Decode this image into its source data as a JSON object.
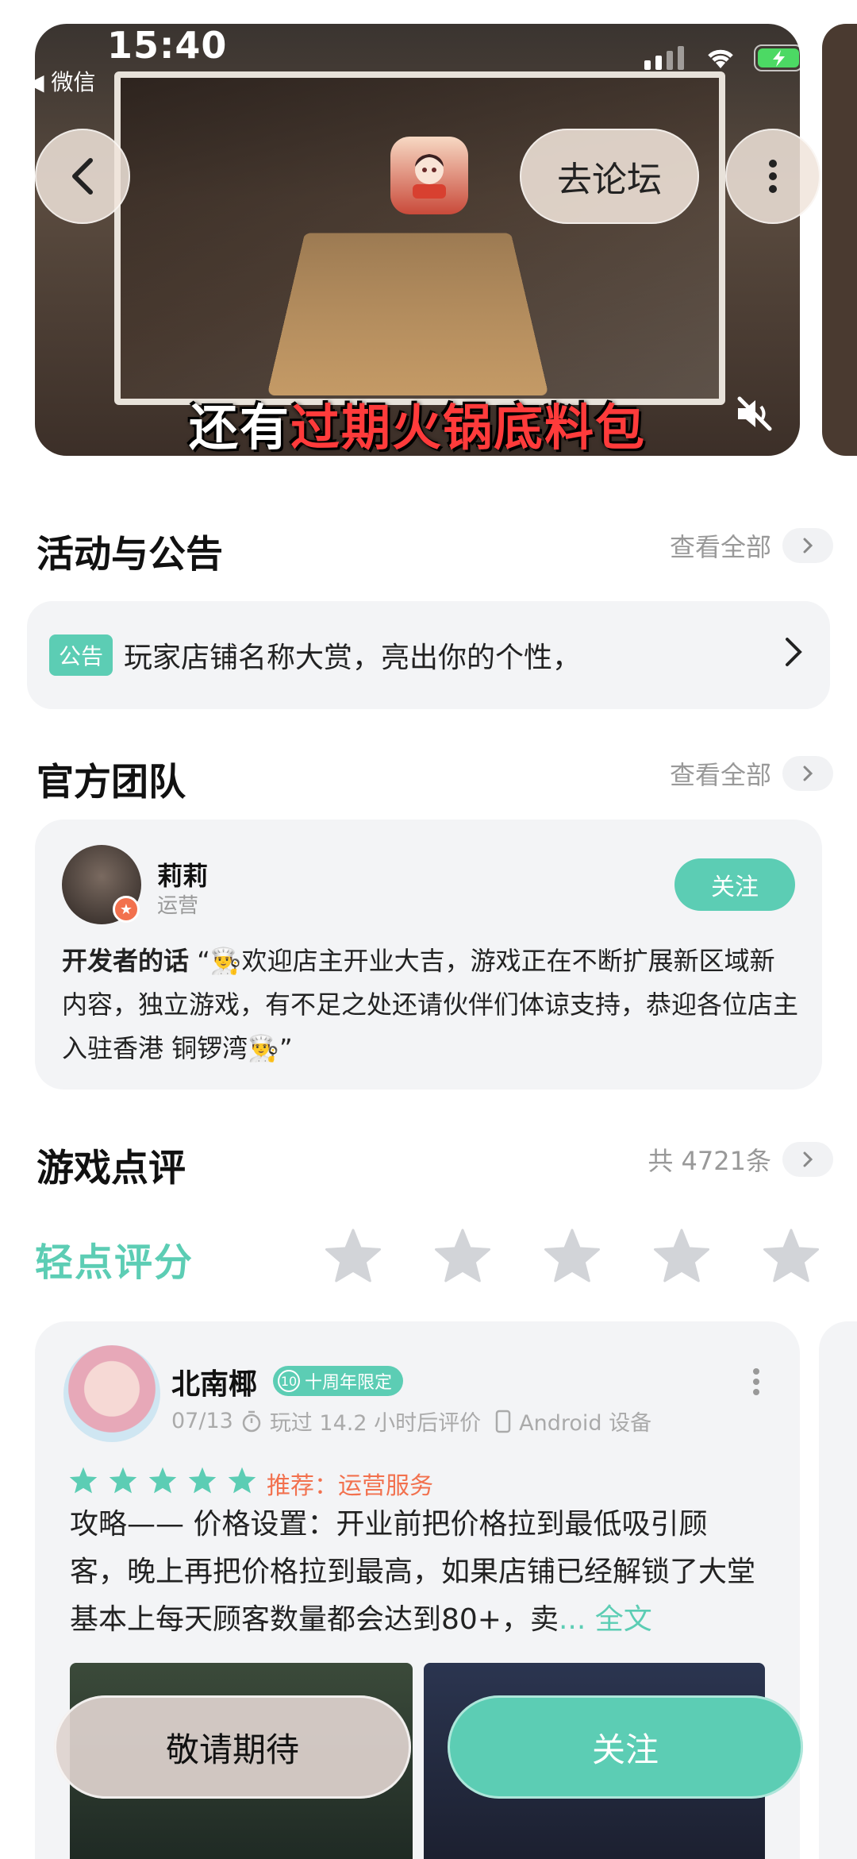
{
  "status_bar": {
    "time": "15:40",
    "back_app": "◀ 微信"
  },
  "hero": {
    "caption_normal": "还有",
    "caption_highlight": "过期火锅底料包",
    "forum_button": "去论坛"
  },
  "announcements": {
    "title": "活动与公告",
    "see_all": "查看全部",
    "tag": "公告",
    "text": "玩家店铺名称大赏，亮出你的个性，"
  },
  "team": {
    "title": "官方团队",
    "see_all": "查看全部",
    "member_name": "莉莉",
    "member_role": "运营",
    "follow": "关注",
    "dev_label": "开发者的话",
    "dev_words": "“👨‍🍳欢迎店主开业大吉，游戏正在不断扩展新区域新内容，独立游戏，有不足之处还请伙伴们体谅支持，恭迎各位店主入驻香港 铜锣湾👨‍🍳”"
  },
  "reviews": {
    "title": "游戏点评",
    "total": "共 4721条",
    "rate_label": "轻点评分",
    "item": {
      "user": "北南椰",
      "badge_num": "10",
      "badge_text": "十周年限定",
      "date": "07/13",
      "played": "玩过 14.2 小时后评价",
      "device": "Android 设备",
      "rating": 5,
      "recommend": "推荐：运营服务",
      "text": "攻略—— 价格设置：开业前把价格拉到最低吸引顾客，晚上再把价格拉到最高，如果店铺已经解锁了大堂基本上每天顾客数量都会达到80+，卖",
      "more": "... 全文"
    }
  },
  "bottom": {
    "wait": "敬请期待",
    "follow": "关注"
  },
  "colors": {
    "accent": "#5ccdb4",
    "orange": "#f2714e",
    "card": "#f3f4f6"
  }
}
